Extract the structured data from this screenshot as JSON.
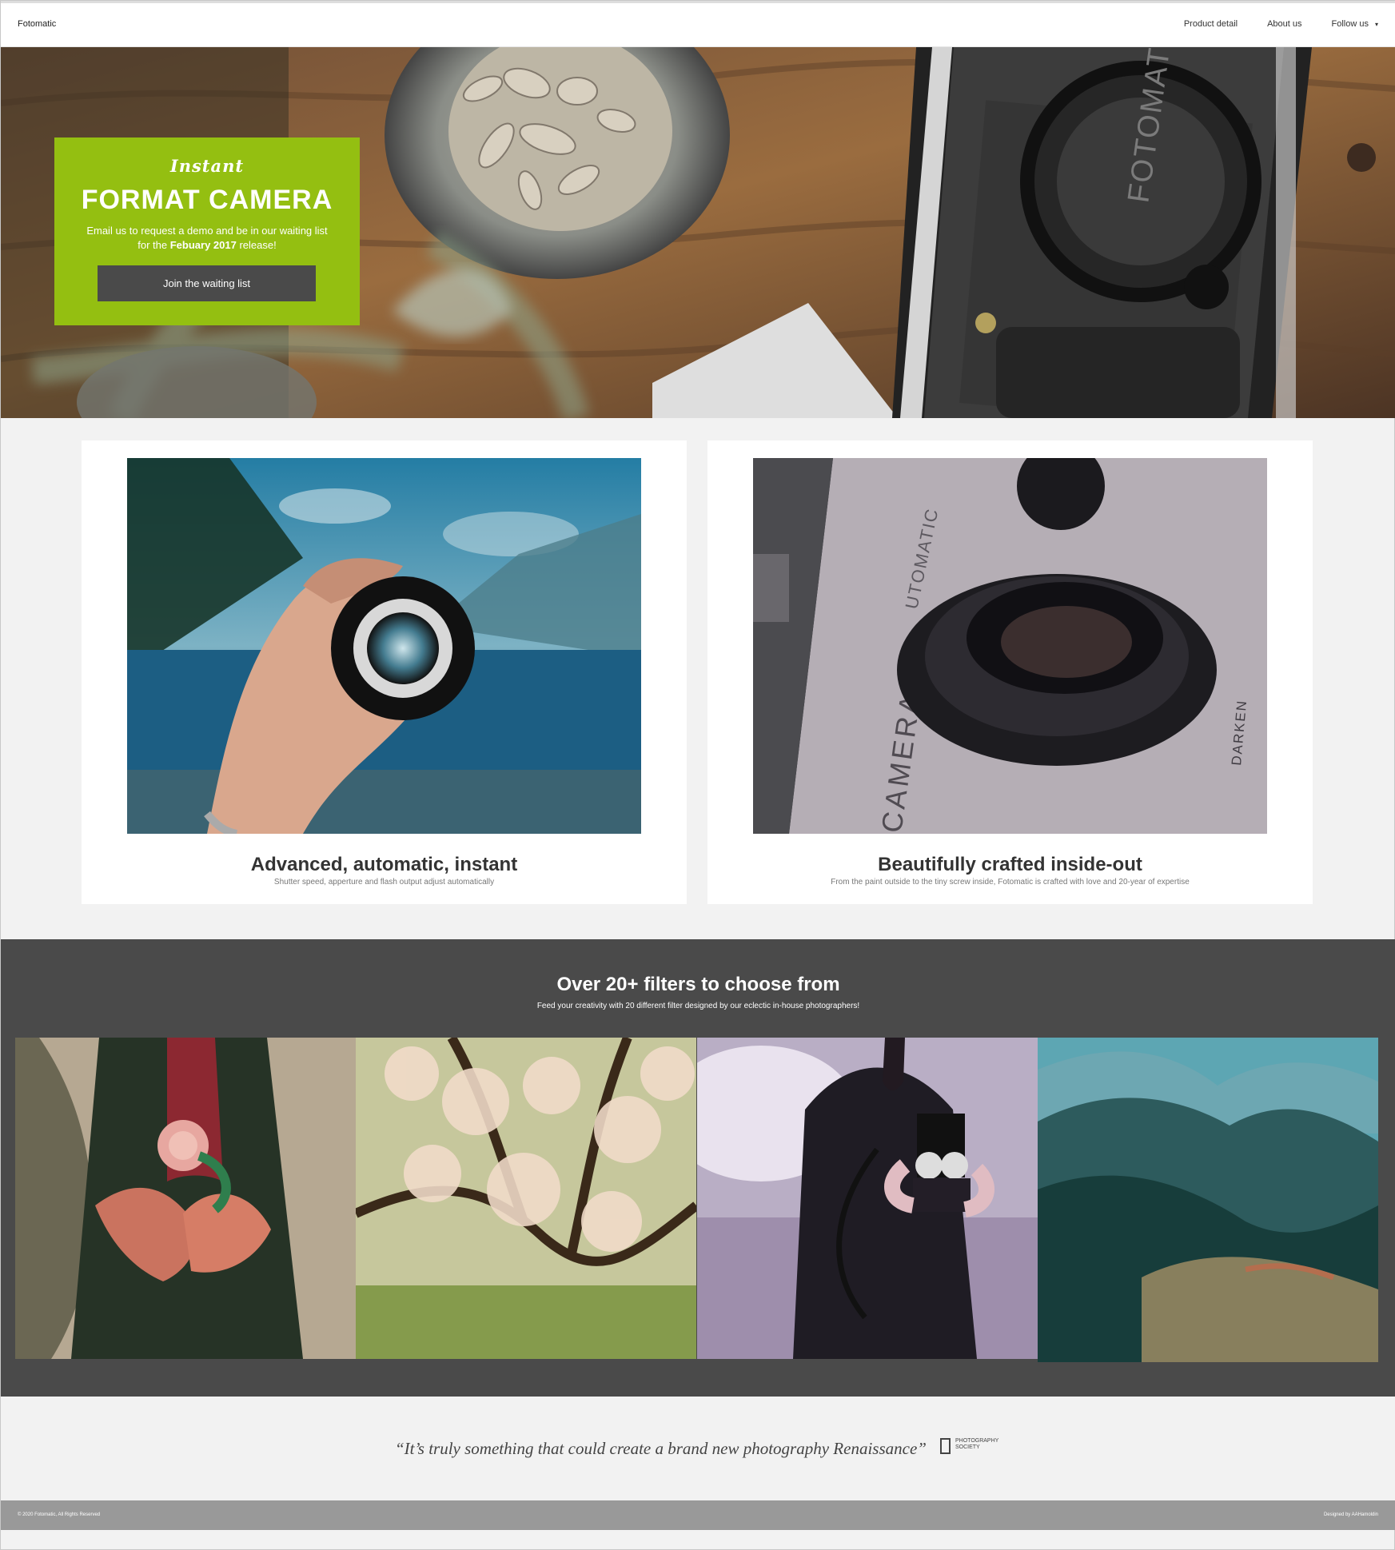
{
  "brand": "Fotomatic",
  "nav": {
    "links": [
      "Product detail",
      "About us",
      "Follow us"
    ],
    "caret": "▾"
  },
  "hero": {
    "kicker": "Instant",
    "title": "FORMAT CAMERA",
    "description_before": "Email us to request a demo and be in our waiting list for the ",
    "description_bold": "Febuary 2017",
    "description_after": " release!",
    "button": "Join the waiting list",
    "camera_label": "FOTOMAT"
  },
  "features": [
    {
      "title": "Advanced, automatic, instant",
      "subtitle": "Shutter speed, apperture and flash output adjust automatically"
    },
    {
      "title": "Beautifully crafted inside-out",
      "subtitle": "From the paint outside to the tiny screw inside, Fotomatic is crafted with love and 20-year of expertise",
      "camera_labels": [
        "UTOMATIC",
        "CAMERA",
        "DARKEN"
      ]
    }
  ],
  "filters": {
    "title": "Over 20+ filters to choose from",
    "subtitle": "Feed your creativity with 20 different filter designed by our eclectic in-house photographers!"
  },
  "testimonial": {
    "quote": "“It’s truly something that could create a brand new photography Renaissance”",
    "source": "PHOTOGRAPHY SOCIETY"
  },
  "footer": {
    "copyright": "© 2020 Fotomatic, All Rights Reserved",
    "designer": "Designed by AAHamoldin"
  },
  "colors": {
    "accent_green": "#94bf11",
    "dark_section": "#4a4a4a",
    "footer": "#999999"
  }
}
